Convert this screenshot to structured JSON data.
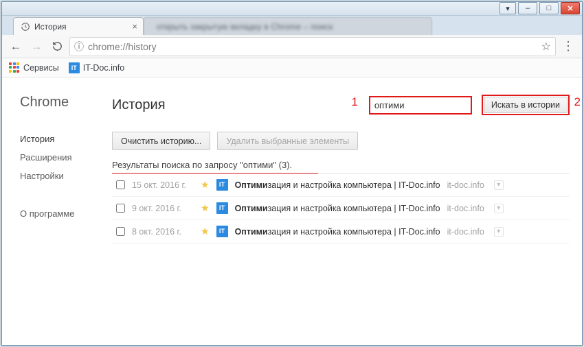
{
  "os": {
    "buttons": {
      "minimize": "–",
      "maximize": "□",
      "close": "✕",
      "dropdown": "▾"
    }
  },
  "tab": {
    "title": "История",
    "background_blurred": "открыть закрытую вкладку в Chrome – поиск"
  },
  "nav": {
    "url": "chrome://history",
    "info_glyph": "ⓘ",
    "star_glyph": "☆",
    "menu_glyph": "⋮"
  },
  "bookmarks": {
    "apps_label": "Сервисы",
    "items": [
      {
        "label": "IT-Doc.info",
        "favicon_text": "IT"
      }
    ]
  },
  "sidebar": {
    "brand": "Chrome",
    "items": [
      "История",
      "Расширения",
      "Настройки"
    ],
    "about": "О программе"
  },
  "page": {
    "title": "История",
    "search_value": "оптими",
    "search_button": "Искать в истории",
    "clear_history": "Очистить историю...",
    "delete_selected": "Удалить выбранные элементы",
    "results_header": "Результаты поиска по запросу \"оптими\" (3).",
    "annotations": {
      "one": "1",
      "two": "2"
    }
  },
  "entries": [
    {
      "date": "15 окт. 2016 г.",
      "title_bold": "Оптими",
      "title_rest": "зация и настройка компьютера | IT-Doc.info",
      "domain_text": "it-doc.info",
      "favicon_text": "IT"
    },
    {
      "date": "9 окт. 2016 г.",
      "title_bold": "Оптими",
      "title_rest": "зация и настройка компьютера | IT-Doc.info",
      "domain_text": "it-doc.info",
      "favicon_text": "IT"
    },
    {
      "date": "8 окт. 2016 г.",
      "title_bold": "Оптими",
      "title_rest": "зация и настройка компьютера | IT-Doc.info",
      "domain_text": "it-doc.info",
      "favicon_text": "IT"
    }
  ]
}
